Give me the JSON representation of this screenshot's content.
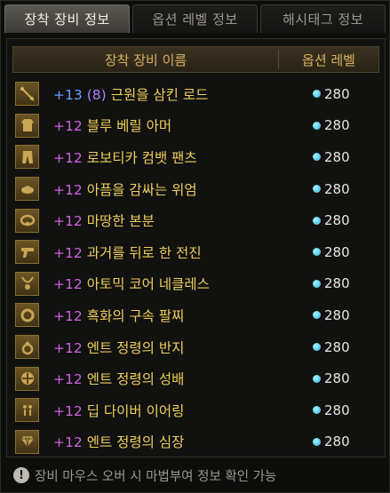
{
  "tabs": [
    {
      "label": "장착 장비 정보",
      "active": true
    },
    {
      "label": "옵션 레벨 정보",
      "active": false
    },
    {
      "label": "해시태그 정보",
      "active": false
    }
  ],
  "table": {
    "header_name": "장착 장비 이름",
    "header_level": "옵션 레벨",
    "rows": [
      {
        "icon": "staff-icon",
        "enhance": "+13",
        "sub": "(8)",
        "name": "근원을 삼킨 로드",
        "level": "280"
      },
      {
        "icon": "armor-icon",
        "enhance": "+12",
        "sub": "",
        "name": "블루 베릴 아머",
        "level": "280"
      },
      {
        "icon": "pants-icon",
        "enhance": "+12",
        "sub": "",
        "name": "로보티카 컴뱃 팬츠",
        "level": "280"
      },
      {
        "icon": "shoulder-icon",
        "enhance": "+12",
        "sub": "",
        "name": "아픔을 감싸는 위엄",
        "level": "280"
      },
      {
        "icon": "belt-icon",
        "enhance": "+12",
        "sub": "",
        "name": "마땅한 본분",
        "level": "280"
      },
      {
        "icon": "gun-icon",
        "enhance": "+12",
        "sub": "",
        "name": "과거를 뒤로 한 전진",
        "level": "280"
      },
      {
        "icon": "necklace-icon",
        "enhance": "+12",
        "sub": "",
        "name": "아토믹 코어 네클레스",
        "level": "280"
      },
      {
        "icon": "bracelet-icon",
        "enhance": "+12",
        "sub": "",
        "name": "흑화의 구속 팔찌",
        "level": "280"
      },
      {
        "icon": "ring-icon",
        "enhance": "+12",
        "sub": "",
        "name": "엔트 정령의 반지",
        "level": "280"
      },
      {
        "icon": "chalice-icon",
        "enhance": "+12",
        "sub": "",
        "name": "엔트 정령의 성배",
        "level": "280"
      },
      {
        "icon": "earring-icon",
        "enhance": "+12",
        "sub": "",
        "name": "딥 다이버 이어링",
        "level": "280"
      },
      {
        "icon": "heart-gem-icon",
        "enhance": "+12",
        "sub": "",
        "name": "엔트 정령의 심장",
        "level": "280"
      }
    ]
  },
  "footer": {
    "info_text": "장비 마우스 오버 시 마법부여 정보 확인 가능"
  },
  "colors": {
    "enhance_blue": "#6aa0ff",
    "enhance_pink": "#d060e0",
    "item_name": "#efd05a",
    "level_dot": "#2cb8e0"
  }
}
